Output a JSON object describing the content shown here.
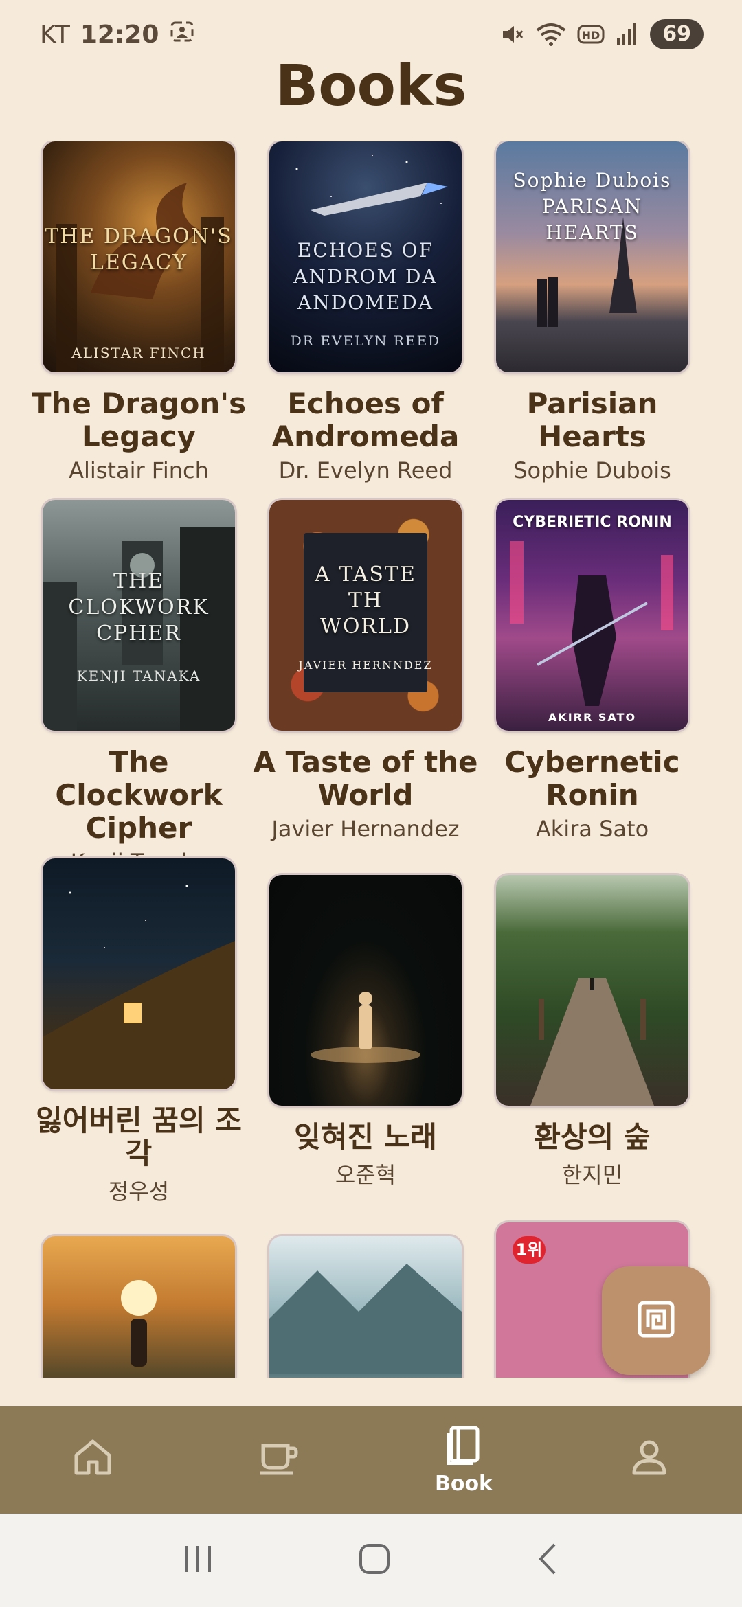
{
  "status_bar": {
    "carrier": "KT",
    "time": "12:20",
    "battery": "69",
    "icons": [
      "screenshot-icon",
      "mute-icon",
      "wifi-icon",
      "hd-icon",
      "signal-icon"
    ]
  },
  "page": {
    "title": "Books"
  },
  "books": [
    {
      "title": "The Dragon's Legacy",
      "author": "Alistair Finch",
      "cover_title": "THE DRAGON'S LEGACY",
      "cover_author": "ALISTAR FINCH"
    },
    {
      "title": "Echoes of Andromeda",
      "author": "Dr. Evelyn Reed",
      "cover_title": "ECHOES OF ANDROM DA ANDOMEDA",
      "cover_author": "DR EVELYN REED"
    },
    {
      "title": "Parisian Hearts",
      "author": "Sophie Dubois",
      "cover_title": "Sophie Dubois PARISAN HEARTS",
      "cover_author": ""
    },
    {
      "title": "The Clockwork Cipher",
      "author": "Kenji Tanaka",
      "cover_title": "THE CLOKWORK CPHER",
      "cover_author": "KENJI TANAKA"
    },
    {
      "title": "A Taste of the World",
      "author": "Javier Hernandez",
      "cover_title": "A TASTE TH WORLD",
      "cover_author": "JAVIER HERNNDEZ"
    },
    {
      "title": "Cybernetic Ronin",
      "author": "Akira Sato",
      "cover_title": "CYBERIETIC RONIN",
      "cover_author": "AKIRR SATO"
    },
    {
      "title": "잃어버린 꿈의 조각",
      "author": "정우성",
      "cover_title": "",
      "cover_author": ""
    },
    {
      "title": "잊혀진 노래",
      "author": "오준혁",
      "cover_title": "",
      "cover_author": ""
    },
    {
      "title": "환상의 숲",
      "author": "한지민",
      "cover_title": "",
      "cover_author": ""
    },
    {
      "title": "",
      "author": "",
      "cover_title": "",
      "cover_author": ""
    },
    {
      "title": "",
      "author": "",
      "cover_title": "",
      "cover_author": ""
    },
    {
      "title": "",
      "author": "",
      "cover_title": "1위",
      "cover_author": ""
    }
  ],
  "bottom_nav": {
    "items": [
      {
        "name": "home",
        "icon": "home-icon",
        "label": ""
      },
      {
        "name": "cafe",
        "icon": "coffee-cup-icon",
        "label": ""
      },
      {
        "name": "book",
        "icon": "book-icon",
        "label": "Book"
      },
      {
        "name": "profile",
        "icon": "person-icon",
        "label": ""
      }
    ],
    "active": "book"
  },
  "fab": {
    "icon": "spiral-square-icon"
  },
  "colors": {
    "background": "#f6eadb",
    "text": "#4a3218",
    "nav_bar": "#8c7a57",
    "fab": "#bd916b"
  }
}
